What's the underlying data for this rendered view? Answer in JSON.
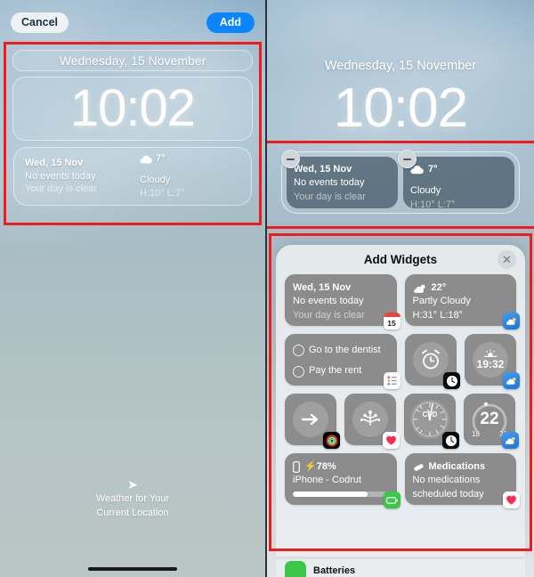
{
  "left_panel": {
    "toolbar": {
      "cancel_label": "Cancel",
      "add_label": "Add"
    },
    "lock_screen": {
      "date": "Wednesday, 15 November",
      "time": "10:02",
      "widgets": [
        {
          "name": "calendar-widget",
          "line1": "Wed, 15 Nov",
          "line2": "No events today",
          "line3": "Your day is clear"
        },
        {
          "name": "weather-widget",
          "icon": "cloud-icon",
          "line1": "7°",
          "line2": "Cloudy",
          "line3": "H:10° L:7°"
        }
      ]
    },
    "attribution": {
      "icon": "location-arrow-icon",
      "line1": "Weather for Your",
      "line2": "Current Location"
    }
  },
  "right_panel": {
    "lock_screen": {
      "date": "Wednesday, 15 November",
      "time": "10:02",
      "widgets": [
        {
          "name": "calendar-widget",
          "remove_badge": "minus-icon",
          "line1": "Wed, 15 Nov",
          "line2": "No events today",
          "line3": "Your day is clear"
        },
        {
          "name": "weather-widget",
          "remove_badge": "minus-icon",
          "icon": "cloud-icon",
          "line1": "7°",
          "line2": "Cloudy",
          "line3": "H:10° L:7°"
        }
      ]
    },
    "sheet": {
      "title": "Add Widgets",
      "close_icon": "close-icon",
      "rows": [
        {
          "tiles": [
            {
              "name": "widget-calendar",
              "kind": "wide",
              "line1": "Wed, 15 Nov",
              "line2": "No events today",
              "line3": "Your day is clear",
              "app_icon": "calendar-app-icon",
              "app_icon_day": "15"
            },
            {
              "name": "widget-weather",
              "kind": "wide",
              "icon": "sun-behind-cloud-icon",
              "line1": "22°",
              "line2": "Partly Cloudy",
              "line3": "H:31° L:18°",
              "app_icon": "weather-app-icon"
            }
          ]
        },
        {
          "tiles": [
            {
              "name": "widget-reminders",
              "kind": "wide",
              "task1": "Go to the dentist",
              "task2": "Pay the rent",
              "app_icon": "reminders-app-icon"
            },
            {
              "name": "widget-alarm",
              "kind": "square",
              "icon": "alarm-clock-icon",
              "app_icon": "clock-app-icon"
            },
            {
              "name": "widget-sunset",
              "kind": "square",
              "icon": "sunset-icon",
              "value": "19:32",
              "app_icon": "weather-app-icon"
            }
          ]
        },
        {
          "tiles": [
            {
              "name": "widget-fitness",
              "kind": "square",
              "icon": "arrow-right-circle-icon",
              "app_icon": "fitness-app-icon"
            },
            {
              "name": "widget-health",
              "kind": "square",
              "icon": "sparkle-tree-icon",
              "app_icon": "health-app-icon"
            },
            {
              "name": "widget-world-clock",
              "kind": "square",
              "icon": "analog-clock-icon",
              "label": "CPD",
              "app_icon": "clock-app-icon"
            },
            {
              "name": "widget-temperature-range",
              "kind": "square",
              "icon": "temperature-ring-icon",
              "value": "22",
              "low": "18",
              "high": "31",
              "app_icon": "weather-app-icon"
            }
          ]
        },
        {
          "tiles": [
            {
              "name": "widget-battery",
              "kind": "wide",
              "icon": "iphone-icon",
              "charge_icon": "bolt-icon",
              "percent": "78%",
              "device": "iPhone - Codrut",
              "progress": 78,
              "app_icon": "batteries-app-icon"
            },
            {
              "name": "widget-medications",
              "kind": "wide",
              "icon": "pill-icon",
              "title": "Medications",
              "line2": "No medications",
              "line3": "scheduled today",
              "app_icon": "health-app-icon"
            }
          ]
        }
      ],
      "below_item": {
        "name": "batteries-list-item",
        "label": "Batteries",
        "app_icon": "batteries-app-icon"
      }
    }
  },
  "annotations": {
    "highlight_color": "#ee1c1c",
    "boxes": [
      "left-lock-widgets-highlight",
      "right-lock-widgets-highlight",
      "right-add-widgets-highlight"
    ]
  }
}
